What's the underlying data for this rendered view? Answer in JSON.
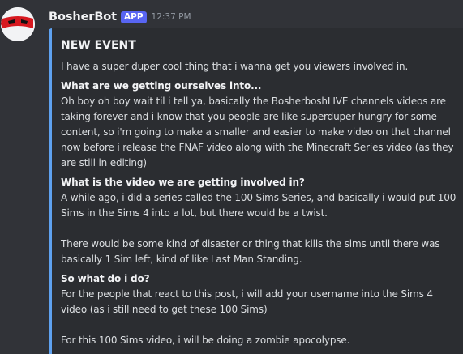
{
  "message": {
    "username": "BosherBot",
    "badge": "APP",
    "timestamp": "12:37 PM",
    "avatar_icon": "red-bandana-mask-icon"
  },
  "embed": {
    "accent_color": "#5ea1ef",
    "title": "NEW EVENT",
    "intro": "I have a super duper cool thing that i wanna get you viewers involved in.",
    "sections": [
      {
        "heading": "What are we getting ourselves into...",
        "paragraphs": [
          "Oh boy oh boy wait til i tell ya, basically the BosherboshLIVE channels videos are taking forever and i know that you people are like superduper hungry for some content, so i'm going to make a smaller and easier to make video on that channel now before i release the FNAF video along with the Minecraft Series video (as they are still in editing)"
        ]
      },
      {
        "heading": "What is the video we are getting involved in?",
        "paragraphs": [
          "A while ago, i did a series called the 100 Sims Series, and basically i would put 100 Sims in the Sims 4 into a lot, but there would be a twist.",
          "There would be some kind of disaster or thing that kills the sims until there was basically 1 Sim left, kind of like Last Man Standing."
        ]
      },
      {
        "heading": "So what do i do?",
        "paragraphs": [
          "For the people that react to this post, i will add your username into the Sims 4 video (as i still need to get these 100 Sims)",
          "For this 100 Sims video, i will be doing a zombie apocolypse."
        ]
      }
    ]
  }
}
